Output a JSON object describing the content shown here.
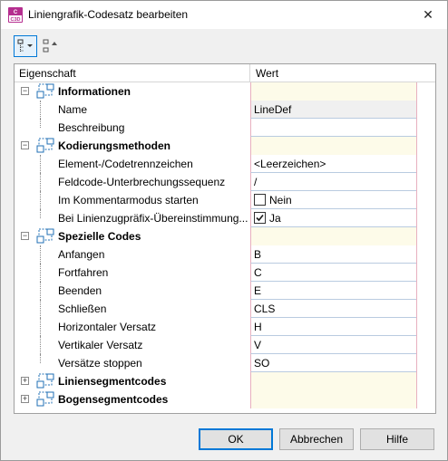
{
  "window": {
    "title": "Liniengrafik-Codesatz bearbeiten",
    "app_icon_text": "C3D",
    "close_glyph": "✕"
  },
  "grid": {
    "header_property": "Eigenschaft",
    "header_value": "Wert"
  },
  "categories": {
    "informationen": {
      "label": "Informationen",
      "name_label": "Name",
      "name_value": "LineDef",
      "beschreibung_label": "Beschreibung",
      "beschreibung_value": ""
    },
    "kodierungsmethoden": {
      "label": "Kodierungsmethoden",
      "elem_label": "Element-/Codetrennzeichen",
      "elem_value": "<Leerzeichen>",
      "feld_label": "Feldcode-Unterbrechungssequenz",
      "feld_value": "/",
      "kommentar_label": "Im Kommentarmodus starten",
      "kommentar_value": "Nein",
      "kommentar_checked": false,
      "praefix_label": "Bei Linienzugpräfix-Übereinstimmung...",
      "praefix_value": "Ja",
      "praefix_checked": true
    },
    "spezielle_codes": {
      "label": "Spezielle Codes",
      "anfangen_label": "Anfangen",
      "anfangen_value": "B",
      "fortfahren_label": "Fortfahren",
      "fortfahren_value": "C",
      "beenden_label": "Beenden",
      "beenden_value": "E",
      "schliessen_label": "Schließen",
      "schliessen_value": "CLS",
      "hversatz_label": "Horizontaler Versatz",
      "hversatz_value": "H",
      "vversatz_label": "Vertikaler Versatz",
      "vversatz_value": "V",
      "stoppen_label": "Versätze stoppen",
      "stoppen_value": "SO"
    },
    "liniensegmentcodes": {
      "label": "Liniensegmentcodes"
    },
    "bogensegmentcodes": {
      "label": "Bogensegmentcodes"
    }
  },
  "buttons": {
    "ok": "OK",
    "cancel": "Abbrechen",
    "help": "Hilfe"
  },
  "colors": {
    "accent": "#0078d7",
    "category_bg": "#fdfbe9",
    "tree_icon": "#1f6fb5"
  }
}
